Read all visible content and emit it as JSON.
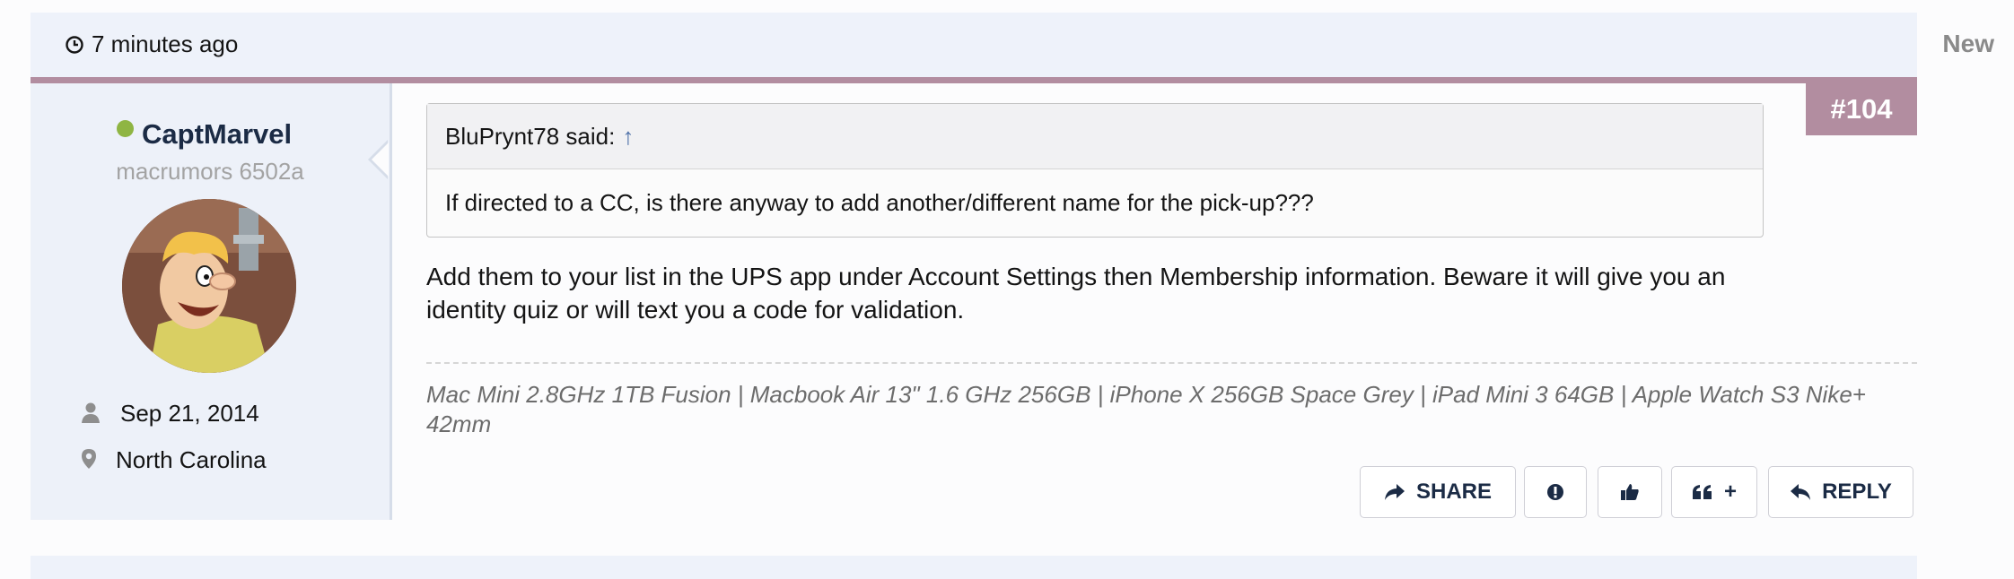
{
  "post": {
    "timestamp": "7 minutes ago",
    "new_label": "New",
    "post_number": "#104"
  },
  "author": {
    "username": "CaptMarvel",
    "user_title": "macrumors 6502a",
    "joined": "Sep 21, 2014",
    "location": "North Carolina",
    "status_color": "#8fb543"
  },
  "quote": {
    "header": "BluPrynt78 said:",
    "arrow": "↑",
    "text": "If directed to a CC, is there anyway to add another/different name for the pick-up???"
  },
  "message": "Add them to your list in the UPS app under Account Settings then Membership information. Beware it will give you an identity quiz or will text you a code for validation.",
  "signature": "Mac Mini 2.8GHz 1TB Fusion | Macbook Air 13\" 1.6 GHz 256GB | iPhone X 256GB Space Grey | iPad Mini 3 64GB | Apple Watch S3 Nike+ 42mm",
  "actions": {
    "share": "SHARE",
    "reply": "REPLY",
    "multiquote_plus": "+"
  },
  "icons": {
    "clock": "clock-icon",
    "user": "user-icon",
    "location": "map-marker-icon",
    "share": "share-arrow-icon",
    "report": "exclamation-circle-icon",
    "like": "thumbs-up-icon",
    "quote": "quote-icon",
    "reply": "reply-icon"
  },
  "colors": {
    "accent": "#b28da0",
    "header_bg": "#eef2fa",
    "name": "#1b2b45"
  }
}
